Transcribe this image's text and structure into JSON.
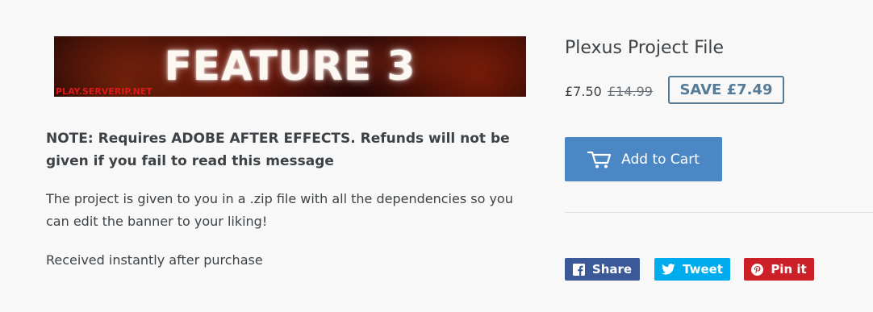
{
  "banner": {
    "title": "FEATURE 3",
    "url": "PLAY.SERVERIP.NET"
  },
  "description": {
    "note": "NOTE: Requires ADOBE AFTER EFFECTS. Refunds will not be given if you fail to read this message",
    "body": "The project is given to you in a .zip file with all the dependencies so you can edit the banner to your liking!",
    "delivery": "Received instantly after purchase"
  },
  "product": {
    "title": "Plexus Project File",
    "price": "£7.50",
    "compare_price": "£14.99",
    "save_label": "SAVE £7.49",
    "add_to_cart_label": "Add to Cart"
  },
  "share": {
    "facebook_label": "Share",
    "twitter_label": "Tweet",
    "pinterest_label": "Pin it"
  },
  "colors": {
    "accent": "#4a87c4",
    "badge": "#557b97",
    "facebook": "#3b5998",
    "twitter": "#00aced",
    "pinterest": "#cb2027"
  },
  "icons": {
    "cart": "cart-icon",
    "facebook": "facebook-icon",
    "twitter": "twitter-icon",
    "pinterest": "pinterest-icon"
  }
}
